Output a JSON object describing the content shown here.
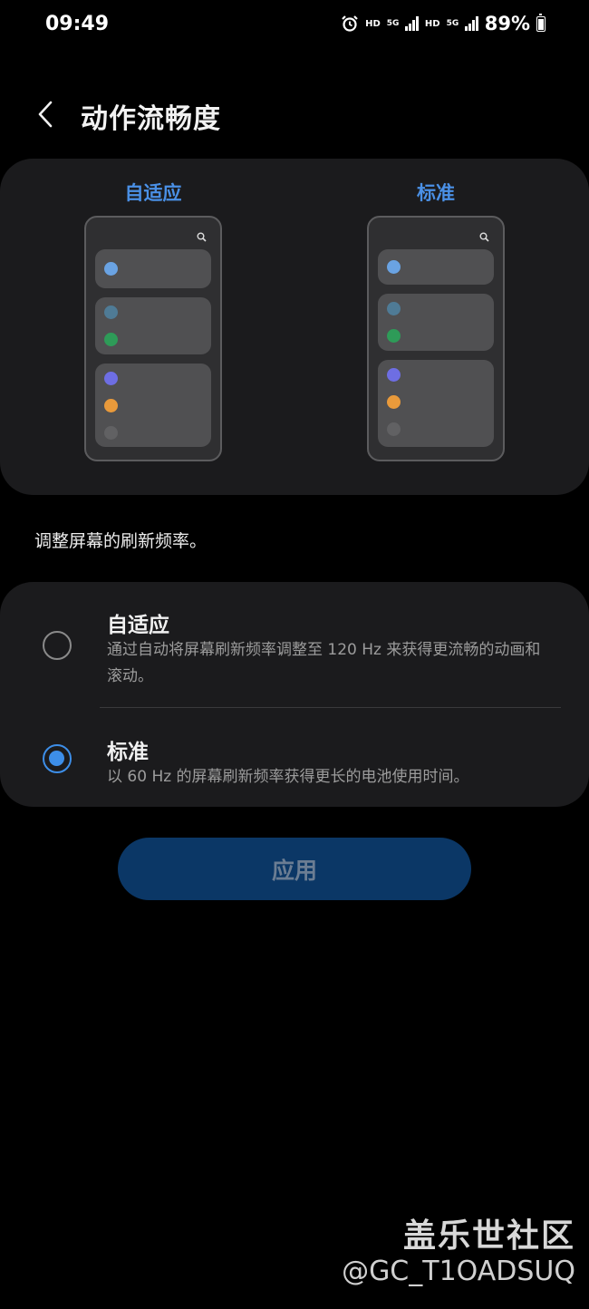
{
  "status_bar": {
    "time": "09:49",
    "hd1": "HD",
    "net1": "5G",
    "hd2": "HD",
    "net2": "5G",
    "battery": "89%",
    "icons": [
      "alarm-icon",
      "signal-icon",
      "signal-icon",
      "battery-icon"
    ]
  },
  "header": {
    "back_icon": "chevron-left-icon",
    "title": "动作流畅度"
  },
  "preview": {
    "adaptive_label": "自适应",
    "standard_label": "标准",
    "dot_colors": [
      "#6aa3e3",
      "#4f7b96",
      "#2e9b58",
      "#6e6ee3",
      "#e99a3b",
      "#616163"
    ]
  },
  "description": "调整屏幕的刷新频率。",
  "options": [
    {
      "title": "自适应",
      "description": "通过自动将屏幕刷新频率调整至 120 Hz 来获得更流畅的动画和滚动。",
      "selected": false
    },
    {
      "title": "标准",
      "description": "以 60 Hz 的屏幕刷新频率获得更长的电池使用时间。",
      "selected": true
    }
  ],
  "apply_label": "应用",
  "watermark": {
    "title": "盖乐世社区",
    "user": "@GC_T1OADSUQ"
  },
  "colors": {
    "accent": "#3d8ee8",
    "label_blue": "#4a90e6",
    "apply_bg": "#0b3766",
    "card_bg": "#1b1b1d"
  }
}
